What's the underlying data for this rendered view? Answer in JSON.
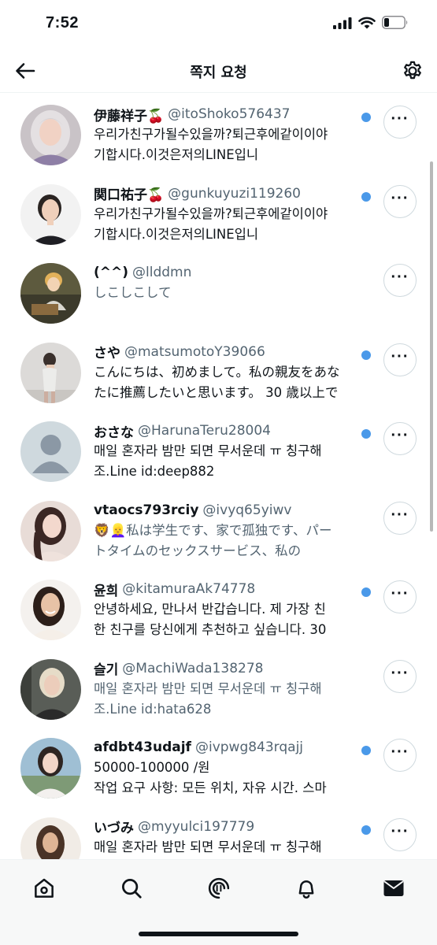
{
  "status_bar": {
    "time": "7:52",
    "battery_level": 0.25
  },
  "header": {
    "title": "쪽지 요청"
  },
  "colors": {
    "unread_dot": "#4a99e9",
    "text": "#0f1419",
    "secondary": "#536471"
  },
  "requests": [
    {
      "name": "伊藤祥子🍒",
      "handle": "@itoShoko576437",
      "snippet": "우리가친구가될수있을까?퇴근후에같이이야\n기합시다.이것은저의LINE입니",
      "unread": true,
      "avatar": "photo-woman-hijab"
    },
    {
      "name": "関口祐子🍒",
      "handle": "@gunkuyuzi119260",
      "snippet": "우리가친구가될수있을까?퇴근후에같이이야\n기합시다.이것은저의LINE입니",
      "unread": true,
      "avatar": "photo-woman-short-hair"
    },
    {
      "name": "(^^)",
      "handle": "@llddmn",
      "snippet": "しこしこして",
      "unread": false,
      "avatar": "photo-anime-character"
    },
    {
      "name": "さや",
      "handle": "@matsumotoY39066",
      "snippet": "こんにちは、初めまして。私の親友をあな\nたに推薦したいと思います。 30 歳以上で",
      "unread": true,
      "avatar": "photo-woman-mirror"
    },
    {
      "name": "おさな",
      "handle": "@HarunaTeru28004",
      "snippet": "매일 혼자라 밤만 되면 무서운데 ㅠ 칭구해\n조.Line id:deep882",
      "unread": true,
      "avatar": "default-avatar"
    },
    {
      "name": "vtaocs793rciy",
      "handle": "@ivyq65yiwv",
      "snippet": "🦁👱‍♀️私は学生です、家で孤独です、パー\nトタイムのセックスサービス、私の",
      "unread": false,
      "avatar": "photo-woman-long-hair"
    },
    {
      "name": "윤희",
      "handle": "@kitamuraAk74778",
      "snippet": "안녕하세요, 만나서 반갑습니다. 제 가장 친\n한 친구를 당신에게 추천하고 싶습니다. 30",
      "unread": true,
      "avatar": "photo-woman-smiling"
    },
    {
      "name": "슬기",
      "handle": "@MachiWada138278",
      "snippet": "매일 혼자라 밤만 되면 무서운데 ㅠ 칭구해\n조.Line id:hata628",
      "unread": false,
      "avatar": "photo-woman-blonde"
    },
    {
      "name": "afdbt43udajf",
      "handle": "@ivpwg843rqajj",
      "snippet": "50000-100000 /원\n작업 요구 사항: 모든 위치, 자유 시간. 스마",
      "unread": true,
      "avatar": "photo-woman-outdoor"
    },
    {
      "name": "いづみ",
      "handle": "@myyulci197779",
      "snippet": "매일 혼자라 밤만 되면 무서운데 ㅠ 칭구해",
      "unread": true,
      "avatar": "photo-woman-curly"
    }
  ],
  "tabs": [
    {
      "name": "home",
      "icon": "home-icon",
      "active": false
    },
    {
      "name": "search",
      "icon": "search-icon",
      "active": false
    },
    {
      "name": "spaces",
      "icon": "spaces-icon",
      "active": false
    },
    {
      "name": "notifications",
      "icon": "bell-icon",
      "active": false
    },
    {
      "name": "messages",
      "icon": "envelope-icon",
      "active": true
    }
  ]
}
